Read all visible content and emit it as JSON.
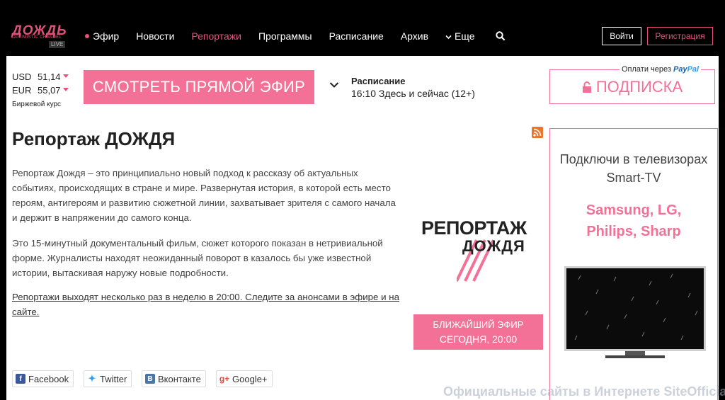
{
  "brand": {
    "logo_word": "ДОЖДЬ",
    "logo_tagline": "OPTIMISTIC CHANNEL",
    "logo_live": "LIVE"
  },
  "nav": {
    "items": [
      {
        "label": "Эфир"
      },
      {
        "label": "Новости"
      },
      {
        "label": "Репортажи"
      },
      {
        "label": "Программы"
      },
      {
        "label": "Расписание"
      },
      {
        "label": "Архив"
      },
      {
        "label": "Еще"
      }
    ],
    "login": "Войти",
    "register": "Регистрация"
  },
  "colors": {
    "accent": "#f37196",
    "nav_active": "#e84f7e"
  },
  "currency": {
    "usd_code": "USD",
    "usd_value": "51,14",
    "eur_code": "EUR",
    "eur_value": "55,07",
    "note": "Биржевой курс"
  },
  "watch_live_button": "СМОТРЕТЬ ПРЯМОЙ ЭФИР",
  "schedule": {
    "title": "Расписание",
    "now": "16:10 Здесь и сейчас (12+)"
  },
  "subscription": {
    "paypal_prefix": "Оплати через",
    "paypal_brand_1": "Pay",
    "paypal_brand_2": "Pal",
    "button": "ПОДПИСКА"
  },
  "article": {
    "title": "Репортаж ДОЖДЯ",
    "p1": "Репортаж Дождя – это принципиально новый подход к рассказу об актуальных событиях, происходящих в стране и мире. Развернутая история, в которой есть место героям, антигероям и развитию сюжетной линии, захватывает зрителя с самого начала и держит в напряжении до самого конца.",
    "p2": "Это 15-минутный документальный фильм, сюжет которого показан в нетривиальной форме. Журналисты находят неожиданный поворот в казалось бы уже известной истории, вытаскивая наружу новые подробности.",
    "p3": "Репортажи выходят несколько раз в неделю в 20:00. Следите за анонсами в эфире и на сайте."
  },
  "program_logo": {
    "line1": "РЕПОРТАЖ",
    "line2": "ДОЖДЯ"
  },
  "next_air": {
    "line1": "БЛИЖАЙШИЙ ЭФИР",
    "line2": "СЕГОДНЯ, 20:00"
  },
  "promo": {
    "line1": "Подключи в телевизорах",
    "line2": "Smart-TV",
    "brands1": "Samsung, LG,",
    "brands2": "Philips, Sharp"
  },
  "share": {
    "facebook": "Facebook",
    "twitter": "Twitter",
    "vkontakte": "Вконтакте",
    "googleplus": "Google+"
  },
  "watermark": "Официальные сайты в Интернете SiteOfficial.ru"
}
